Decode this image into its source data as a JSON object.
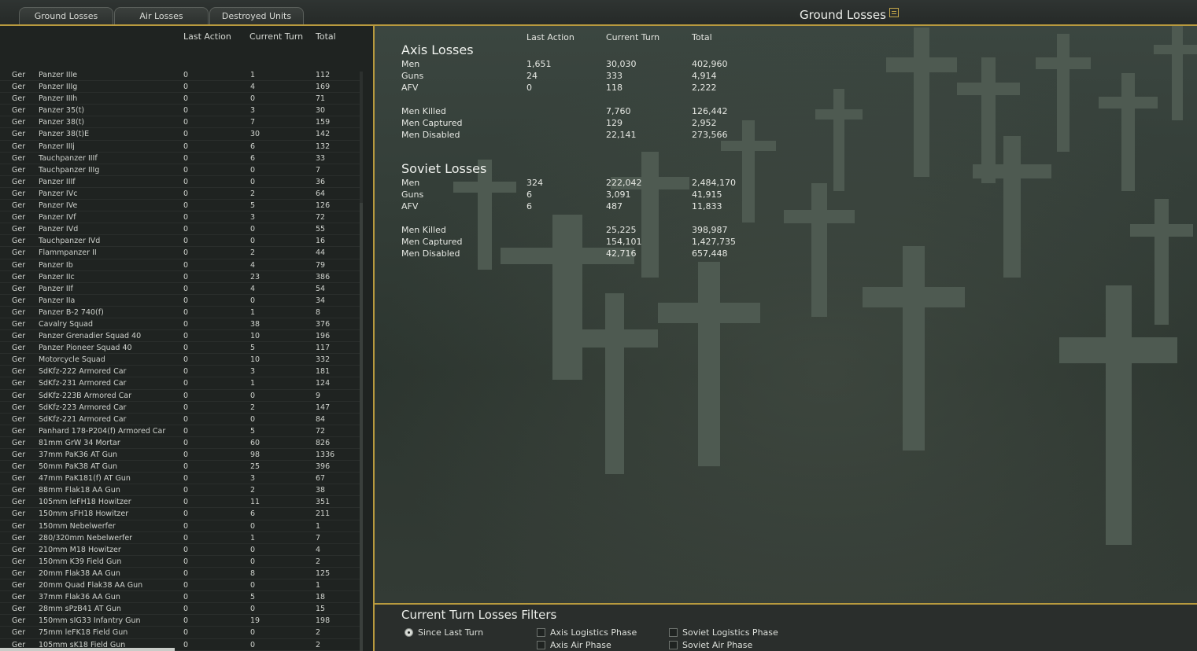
{
  "tabs": [
    {
      "label": "Ground Losses"
    },
    {
      "label": "Air Losses"
    },
    {
      "label": "Destroyed Units"
    }
  ],
  "page_title": "Ground Losses",
  "report_icon": "report-icon",
  "unit_table": {
    "headers": {
      "last": "Last Action",
      "current": "Current Turn",
      "total": "Total"
    },
    "rows": [
      [
        "Ger",
        "Panzer IIIe",
        "0",
        "1",
        "112"
      ],
      [
        "Ger",
        "Panzer IIIg",
        "0",
        "4",
        "169"
      ],
      [
        "Ger",
        "Panzer IIIh",
        "0",
        "0",
        "71"
      ],
      [
        "Ger",
        "Panzer 35(t)",
        "0",
        "3",
        "30"
      ],
      [
        "Ger",
        "Panzer 38(t)",
        "0",
        "7",
        "159"
      ],
      [
        "Ger",
        "Panzer 38(t)E",
        "0",
        "30",
        "142"
      ],
      [
        "Ger",
        "Panzer IIIj",
        "0",
        "6",
        "132"
      ],
      [
        "Ger",
        "Tauchpanzer IIIf",
        "0",
        "6",
        "33"
      ],
      [
        "Ger",
        "Tauchpanzer IIIg",
        "0",
        "0",
        "7"
      ],
      [
        "Ger",
        "Panzer IIIf",
        "0",
        "0",
        "36"
      ],
      [
        "Ger",
        "Panzer IVc",
        "0",
        "2",
        "64"
      ],
      [
        "Ger",
        "Panzer IVe",
        "0",
        "5",
        "126"
      ],
      [
        "Ger",
        "Panzer IVf",
        "0",
        "3",
        "72"
      ],
      [
        "Ger",
        "Panzer IVd",
        "0",
        "0",
        "55"
      ],
      [
        "Ger",
        "Tauchpanzer IVd",
        "0",
        "0",
        "16"
      ],
      [
        "Ger",
        "Flammpanzer II",
        "0",
        "2",
        "44"
      ],
      [
        "Ger",
        "Panzer Ib",
        "0",
        "4",
        "79"
      ],
      [
        "Ger",
        "Panzer IIc",
        "0",
        "23",
        "386"
      ],
      [
        "Ger",
        "Panzer IIf",
        "0",
        "4",
        "54"
      ],
      [
        "Ger",
        "Panzer IIa",
        "0",
        "0",
        "34"
      ],
      [
        "Ger",
        "Panzer B-2 740(f)",
        "0",
        "1",
        "8"
      ],
      [
        "Ger",
        "Cavalry Squad",
        "0",
        "38",
        "376"
      ],
      [
        "Ger",
        "Panzer Grenadier Squad 40",
        "0",
        "10",
        "196"
      ],
      [
        "Ger",
        "Panzer Pioneer Squad 40",
        "0",
        "5",
        "117"
      ],
      [
        "Ger",
        "Motorcycle Squad",
        "0",
        "10",
        "332"
      ],
      [
        "Ger",
        "SdKfz-222 Armored Car",
        "0",
        "3",
        "181"
      ],
      [
        "Ger",
        "SdKfz-231 Armored Car",
        "0",
        "1",
        "124"
      ],
      [
        "Ger",
        "SdKfz-223B Armored Car",
        "0",
        "0",
        "9"
      ],
      [
        "Ger",
        "SdKfz-223 Armored Car",
        "0",
        "2",
        "147"
      ],
      [
        "Ger",
        "SdKfz-221 Armored Car",
        "0",
        "0",
        "84"
      ],
      [
        "Ger",
        "Panhard 178-P204(f) Armored Car",
        "0",
        "5",
        "72"
      ],
      [
        "Ger",
        "81mm GrW 34 Mortar",
        "0",
        "60",
        "826"
      ],
      [
        "Ger",
        "37mm PaK36 AT Gun",
        "0",
        "98",
        "1336"
      ],
      [
        "Ger",
        "50mm PaK38 AT Gun",
        "0",
        "25",
        "396"
      ],
      [
        "Ger",
        "47mm PaK181(f) AT Gun",
        "0",
        "3",
        "67"
      ],
      [
        "Ger",
        "88mm Flak18 AA Gun",
        "0",
        "2",
        "38"
      ],
      [
        "Ger",
        "105mm leFH18 Howitzer",
        "0",
        "11",
        "351"
      ],
      [
        "Ger",
        "150mm sFH18 Howitzer",
        "0",
        "6",
        "211"
      ],
      [
        "Ger",
        "150mm Nebelwerfer",
        "0",
        "0",
        "1"
      ],
      [
        "Ger",
        "280/320mm Nebelwerfer",
        "0",
        "1",
        "7"
      ],
      [
        "Ger",
        "210mm M18 Howitzer",
        "0",
        "0",
        "4"
      ],
      [
        "Ger",
        "150mm K39 Field Gun",
        "0",
        "0",
        "2"
      ],
      [
        "Ger",
        "20mm Flak38 AA Gun",
        "0",
        "8",
        "125"
      ],
      [
        "Ger",
        "20mm Quad Flak38 AA Gun",
        "0",
        "0",
        "1"
      ],
      [
        "Ger",
        "37mm Flak36 AA Gun",
        "0",
        "5",
        "18"
      ],
      [
        "Ger",
        "28mm sPzB41 AT Gun",
        "0",
        "0",
        "15"
      ],
      [
        "Ger",
        "150mm sIG33 Infantry Gun",
        "0",
        "19",
        "198"
      ],
      [
        "Ger",
        "75mm leFK18 Field Gun",
        "0",
        "0",
        "2"
      ],
      [
        "Ger",
        "105mm sK18 Field Gun",
        "0",
        "0",
        "2"
      ]
    ]
  },
  "summary": {
    "headers": {
      "last": "Last Action",
      "current": "Current Turn",
      "total": "Total"
    },
    "axis": {
      "title": "Axis Losses",
      "rows": [
        [
          "Men",
          "1,651",
          "30,030",
          "402,960"
        ],
        [
          "Guns",
          "24",
          "333",
          "4,914"
        ],
        [
          "AFV",
          "0",
          "118",
          "2,222"
        ],
        [
          "Men Killed",
          "",
          "7,760",
          "126,442"
        ],
        [
          "Men Captured",
          "",
          "129",
          "2,952"
        ],
        [
          "Men Disabled",
          "",
          "22,141",
          "273,566"
        ]
      ]
    },
    "soviet": {
      "title": "Soviet Losses",
      "rows": [
        [
          "Men",
          "324",
          "222,042",
          "2,484,170"
        ],
        [
          "Guns",
          "6",
          "3,091",
          "41,915"
        ],
        [
          "AFV",
          "6",
          "487",
          "11,833"
        ],
        [
          "Men Killed",
          "",
          "25,225",
          "398,987"
        ],
        [
          "Men Captured",
          "",
          "154,101",
          "1,427,735"
        ],
        [
          "Men Disabled",
          "",
          "42,716",
          "657,448"
        ]
      ]
    }
  },
  "filters": {
    "title": "Current Turn Losses Filters",
    "since_last_turn": "Since Last Turn",
    "axis_logistics": "Axis Logistics Phase",
    "axis_air": "Axis Air Phase",
    "soviet_logistics": "Soviet Logistics Phase",
    "soviet_air": "Soviet Air Phase",
    "selected": "Since Last Turn"
  },
  "colors": {
    "accent_border": "#b89a3e",
    "panel_bg": "#1f2321",
    "cemetery_bg": "#2c352f"
  }
}
